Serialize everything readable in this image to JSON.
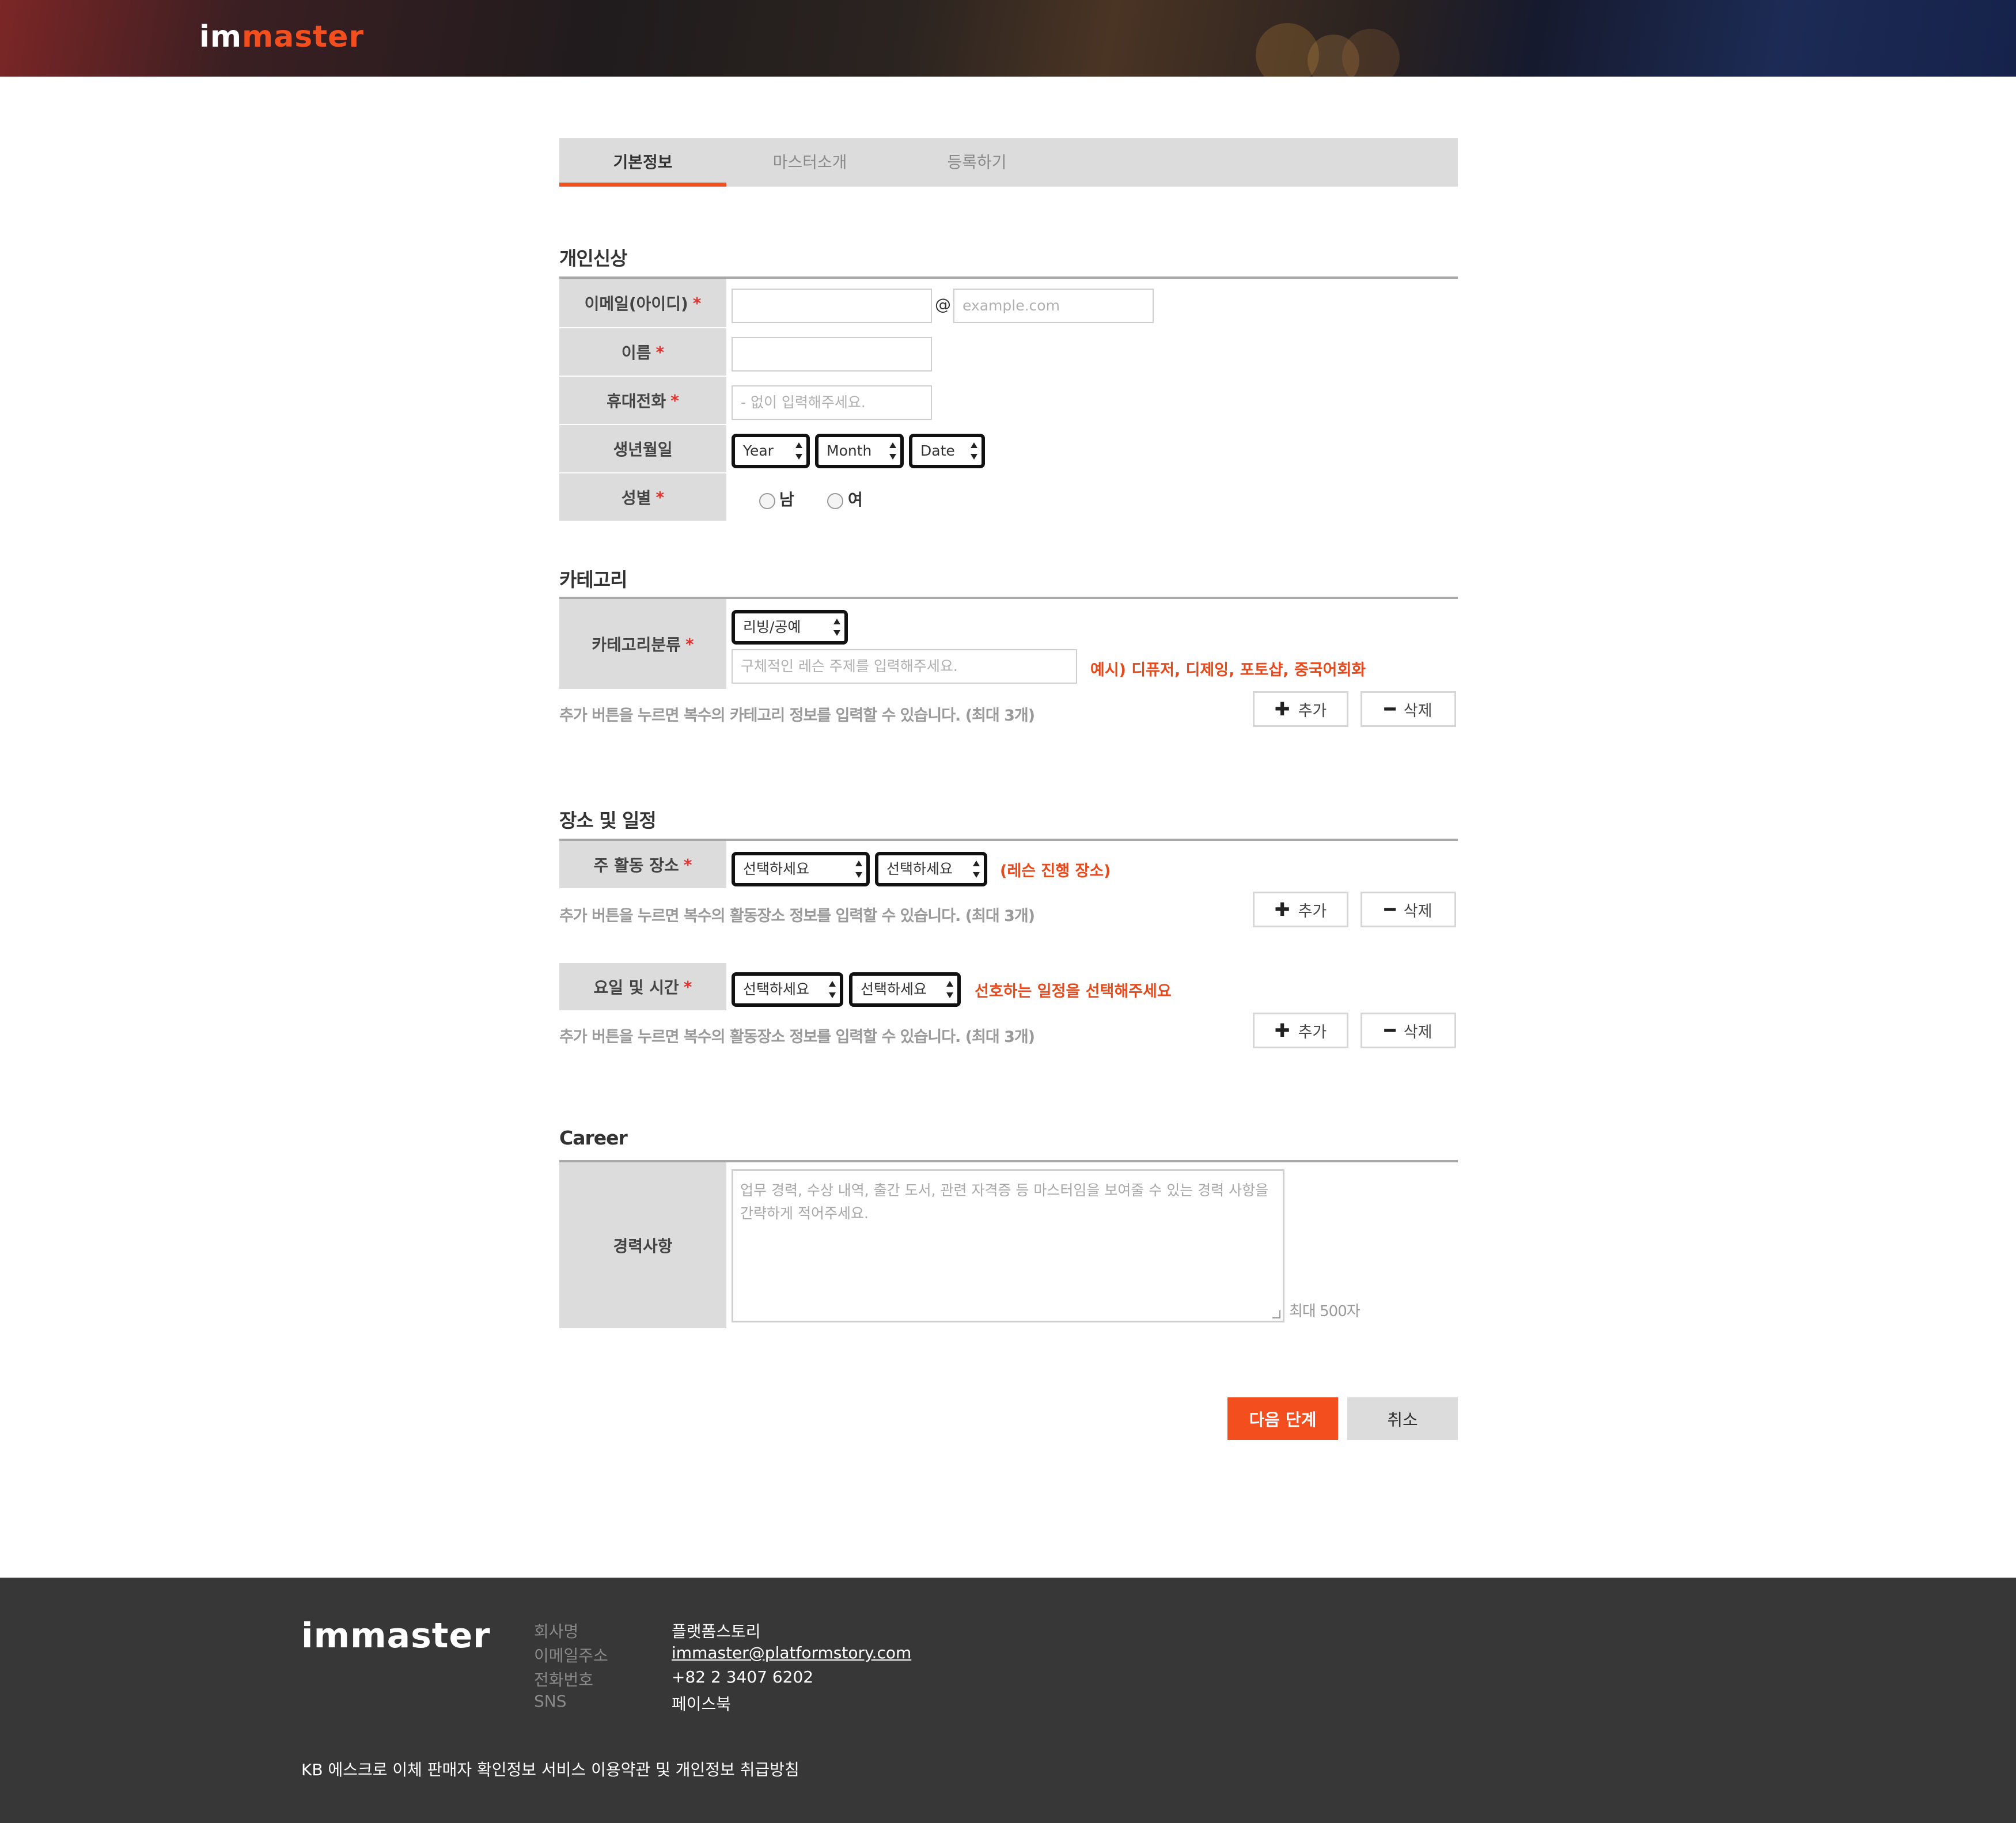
{
  "header": {
    "logo_a": "im",
    "logo_b": "master"
  },
  "tabs": [
    {
      "label": "기본정보",
      "active": true
    },
    {
      "label": "마스터소개",
      "active": false
    },
    {
      "label": "등록하기",
      "active": false
    }
  ],
  "personal": {
    "title": "개인신상",
    "email_label": "이메일(아이디)",
    "email_at": "@",
    "email_domain_placeholder": "example.com",
    "name_label": "이름",
    "phone_label": "휴대전화",
    "phone_placeholder": "- 없이 입력해주세요.",
    "birth_label": "생년월일",
    "birth_year": "Year",
    "birth_month": "Month",
    "birth_date": "Date",
    "gender_label": "성별",
    "gender_male": "남",
    "gender_female": "여",
    "required_mark": "*"
  },
  "category": {
    "title": "카테고리",
    "label": "카테고리분류",
    "select_value": "리빙/공예",
    "detail_placeholder": "구체적인 레슨 주제를 입력해주세요.",
    "example_hint": "예시) 디퓨저, 디제잉, 포토샵, 중국어회화",
    "help": "추가 버튼을 누르면 복수의 카테고리 정보를 입력할 수 있습니다. (최대 3개)"
  },
  "schedule": {
    "title": "장소 및 일정",
    "place_label": "주 활동 장소",
    "place_select_1": "선택하세요",
    "place_select_2": "선택하세요",
    "place_hint": "(레슨 진행 장소)",
    "place_help": "추가 버튼을 누르면 복수의 활동장소 정보를 입력할 수 있습니다. (최대 3개)",
    "time_label": "요일 및 시간",
    "time_select_1": "선택하세요",
    "time_select_2": "선택하세요",
    "time_hint": "선호하는 일정을 선택해주세요",
    "time_help": "추가 버튼을 누르면 복수의 활동장소 정보를 입력할 수 있습니다. (최대 3개)"
  },
  "buttons": {
    "add": "추가",
    "add_icon": "✚",
    "remove": "삭제",
    "remove_icon": "━",
    "next": "다음 단계",
    "cancel": "취소"
  },
  "career": {
    "title": "Career",
    "label": "경력사항",
    "placeholder": "업무 경력, 수상 내역, 출간 도서, 관련 자격증 등 마스터임을 보여줄 수 있는 경력 사항을 간략하게 적어주세요.",
    "counter": "최대 500자"
  },
  "footer": {
    "logo": "immaster",
    "company_key": "회사명",
    "company_val": "플랫폼스토리",
    "email_key": "이메일주소",
    "email_val": "immaster@platformstory.com",
    "phone_key": "전화번호",
    "phone_val": "+82 2 3407 6202",
    "sns_key": "SNS",
    "sns_val": "페이스북",
    "bottom": "KB 에스크로 이체 판매자 확인정보 서비스 이용약관 및 개인정보 취급방침"
  },
  "colors": {
    "accent": "#f24e1e",
    "label_bg": "#dcdcdc",
    "footer_bg": "#373737"
  }
}
